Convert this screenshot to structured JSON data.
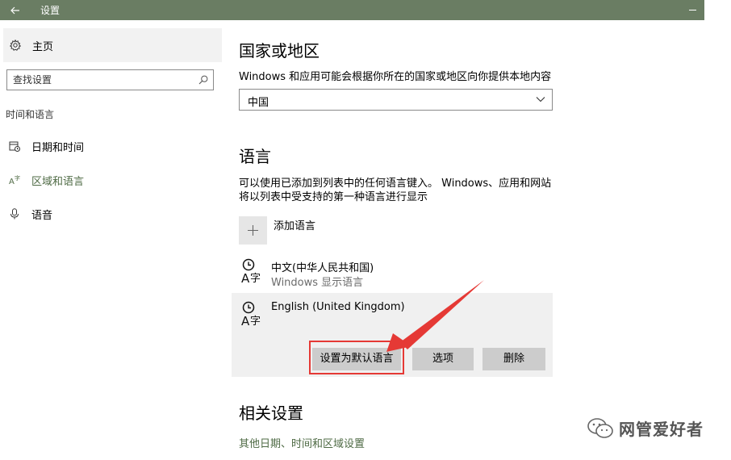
{
  "window": {
    "title": "设置"
  },
  "sidebar": {
    "home_label": "主页",
    "search_placeholder": "查找设置",
    "section_label": "时间和语言",
    "items": [
      {
        "label": "日期和时间",
        "icon": "calendar-clock-icon",
        "active": false
      },
      {
        "label": "区域和语言",
        "icon": "language-icon",
        "active": true
      },
      {
        "label": "语音",
        "icon": "microphone-icon",
        "active": false
      }
    ]
  },
  "region": {
    "title": "国家或地区",
    "description": "Windows 和应用可能会根据你所在的国家或地区向你提供本地内容",
    "selected": "中国"
  },
  "language": {
    "title": "语言",
    "description_line1": "可以使用已添加到列表中的任何语言键入。 Windows、应用和网站",
    "description_line2": "将以列表中受支持的第一种语言进行显示",
    "add_label": "添加语言",
    "items": [
      {
        "name": "中文(中华人民共和国)",
        "sub": "Windows 显示语言"
      },
      {
        "name": "English (United Kingdom)",
        "sub": ""
      }
    ],
    "buttons": {
      "set_default": "设置为默认语言",
      "options": "选项",
      "remove": "删除"
    }
  },
  "related": {
    "title": "相关设置",
    "link": "其他日期、时间和区域设置"
  },
  "watermark": {
    "text": "网管爱好者"
  },
  "colors": {
    "titlebar": "#6a7d63",
    "accent": "#4f6b45",
    "annotation": "#e53935"
  }
}
